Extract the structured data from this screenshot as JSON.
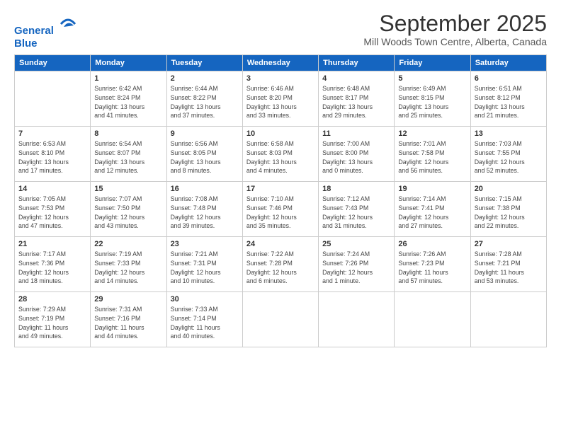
{
  "header": {
    "logo_line1": "General",
    "logo_line2": "Blue",
    "month": "September 2025",
    "location": "Mill Woods Town Centre, Alberta, Canada"
  },
  "weekdays": [
    "Sunday",
    "Monday",
    "Tuesday",
    "Wednesday",
    "Thursday",
    "Friday",
    "Saturday"
  ],
  "weeks": [
    [
      {
        "day": "",
        "info": ""
      },
      {
        "day": "1",
        "info": "Sunrise: 6:42 AM\nSunset: 8:24 PM\nDaylight: 13 hours\nand 41 minutes."
      },
      {
        "day": "2",
        "info": "Sunrise: 6:44 AM\nSunset: 8:22 PM\nDaylight: 13 hours\nand 37 minutes."
      },
      {
        "day": "3",
        "info": "Sunrise: 6:46 AM\nSunset: 8:20 PM\nDaylight: 13 hours\nand 33 minutes."
      },
      {
        "day": "4",
        "info": "Sunrise: 6:48 AM\nSunset: 8:17 PM\nDaylight: 13 hours\nand 29 minutes."
      },
      {
        "day": "5",
        "info": "Sunrise: 6:49 AM\nSunset: 8:15 PM\nDaylight: 13 hours\nand 25 minutes."
      },
      {
        "day": "6",
        "info": "Sunrise: 6:51 AM\nSunset: 8:12 PM\nDaylight: 13 hours\nand 21 minutes."
      }
    ],
    [
      {
        "day": "7",
        "info": "Sunrise: 6:53 AM\nSunset: 8:10 PM\nDaylight: 13 hours\nand 17 minutes."
      },
      {
        "day": "8",
        "info": "Sunrise: 6:54 AM\nSunset: 8:07 PM\nDaylight: 13 hours\nand 12 minutes."
      },
      {
        "day": "9",
        "info": "Sunrise: 6:56 AM\nSunset: 8:05 PM\nDaylight: 13 hours\nand 8 minutes."
      },
      {
        "day": "10",
        "info": "Sunrise: 6:58 AM\nSunset: 8:03 PM\nDaylight: 13 hours\nand 4 minutes."
      },
      {
        "day": "11",
        "info": "Sunrise: 7:00 AM\nSunset: 8:00 PM\nDaylight: 13 hours\nand 0 minutes."
      },
      {
        "day": "12",
        "info": "Sunrise: 7:01 AM\nSunset: 7:58 PM\nDaylight: 12 hours\nand 56 minutes."
      },
      {
        "day": "13",
        "info": "Sunrise: 7:03 AM\nSunset: 7:55 PM\nDaylight: 12 hours\nand 52 minutes."
      }
    ],
    [
      {
        "day": "14",
        "info": "Sunrise: 7:05 AM\nSunset: 7:53 PM\nDaylight: 12 hours\nand 47 minutes."
      },
      {
        "day": "15",
        "info": "Sunrise: 7:07 AM\nSunset: 7:50 PM\nDaylight: 12 hours\nand 43 minutes."
      },
      {
        "day": "16",
        "info": "Sunrise: 7:08 AM\nSunset: 7:48 PM\nDaylight: 12 hours\nand 39 minutes."
      },
      {
        "day": "17",
        "info": "Sunrise: 7:10 AM\nSunset: 7:46 PM\nDaylight: 12 hours\nand 35 minutes."
      },
      {
        "day": "18",
        "info": "Sunrise: 7:12 AM\nSunset: 7:43 PM\nDaylight: 12 hours\nand 31 minutes."
      },
      {
        "day": "19",
        "info": "Sunrise: 7:14 AM\nSunset: 7:41 PM\nDaylight: 12 hours\nand 27 minutes."
      },
      {
        "day": "20",
        "info": "Sunrise: 7:15 AM\nSunset: 7:38 PM\nDaylight: 12 hours\nand 22 minutes."
      }
    ],
    [
      {
        "day": "21",
        "info": "Sunrise: 7:17 AM\nSunset: 7:36 PM\nDaylight: 12 hours\nand 18 minutes."
      },
      {
        "day": "22",
        "info": "Sunrise: 7:19 AM\nSunset: 7:33 PM\nDaylight: 12 hours\nand 14 minutes."
      },
      {
        "day": "23",
        "info": "Sunrise: 7:21 AM\nSunset: 7:31 PM\nDaylight: 12 hours\nand 10 minutes."
      },
      {
        "day": "24",
        "info": "Sunrise: 7:22 AM\nSunset: 7:28 PM\nDaylight: 12 hours\nand 6 minutes."
      },
      {
        "day": "25",
        "info": "Sunrise: 7:24 AM\nSunset: 7:26 PM\nDaylight: 12 hours\nand 1 minute."
      },
      {
        "day": "26",
        "info": "Sunrise: 7:26 AM\nSunset: 7:23 PM\nDaylight: 11 hours\nand 57 minutes."
      },
      {
        "day": "27",
        "info": "Sunrise: 7:28 AM\nSunset: 7:21 PM\nDaylight: 11 hours\nand 53 minutes."
      }
    ],
    [
      {
        "day": "28",
        "info": "Sunrise: 7:29 AM\nSunset: 7:19 PM\nDaylight: 11 hours\nand 49 minutes."
      },
      {
        "day": "29",
        "info": "Sunrise: 7:31 AM\nSunset: 7:16 PM\nDaylight: 11 hours\nand 44 minutes."
      },
      {
        "day": "30",
        "info": "Sunrise: 7:33 AM\nSunset: 7:14 PM\nDaylight: 11 hours\nand 40 minutes."
      },
      {
        "day": "",
        "info": ""
      },
      {
        "day": "",
        "info": ""
      },
      {
        "day": "",
        "info": ""
      },
      {
        "day": "",
        "info": ""
      }
    ]
  ]
}
